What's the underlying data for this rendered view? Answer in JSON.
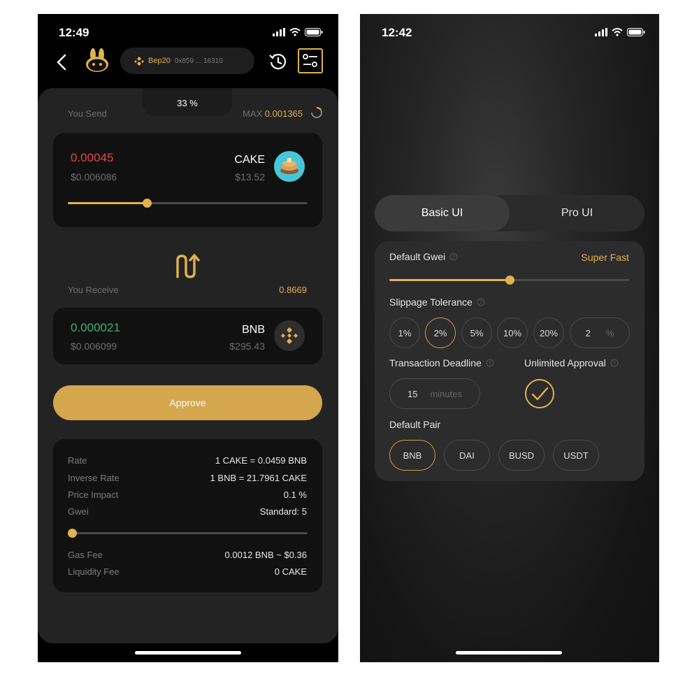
{
  "left": {
    "status_time": "12:49",
    "wallet_chain": "Bep20",
    "wallet_address": "0x859 ... 16310",
    "send": {
      "label": "You Send",
      "percent": "33 %",
      "max_label": "MAX",
      "max_value": "0.001365",
      "amount": "0.00045",
      "amount_usd": "$0.006086",
      "token": "CAKE",
      "token_price": "$13.52",
      "slider_fraction": 0.33
    },
    "receive": {
      "label": "You Receive",
      "value": "0.8669",
      "amount": "0.000021",
      "amount_usd": "$0.006099",
      "token": "BNB",
      "token_price": "$295.43"
    },
    "approve_label": "Approve",
    "details": {
      "rows": [
        {
          "label": "Rate",
          "value": "1 CAKE = 0.0459 BNB"
        },
        {
          "label": "Inverse Rate",
          "value": "1 BNB = 21.7961 CAKE"
        },
        {
          "label": "Price Impact",
          "value": "0.1 %"
        },
        {
          "label": "Gwei",
          "value": "Standard: 5"
        }
      ],
      "gwei_slider_fraction": 0.0,
      "fees": [
        {
          "label": "Gas Fee",
          "value": "0.0012 BNB ~ $0.36"
        },
        {
          "label": "Liquidity Fee",
          "value": "0 CAKE"
        }
      ]
    },
    "colors": {
      "accent": "#e0b24f",
      "send_amount": "#e0474c",
      "receive_amount": "#3fae7a"
    }
  },
  "right": {
    "status_time": "12:42",
    "tabs": [
      {
        "label": "Basic UI",
        "active": true
      },
      {
        "label": "Pro UI",
        "active": false
      }
    ],
    "gwei": {
      "label": "Default Gwei",
      "value": "Super Fast",
      "slider_fraction": 0.5
    },
    "slippage": {
      "label": "Slippage Tolerance",
      "options": [
        "1%",
        "2%",
        "5%",
        "10%",
        "20%"
      ],
      "selected": "2%",
      "custom_value": "2",
      "custom_unit": "%"
    },
    "deadline": {
      "label": "Transaction Deadline",
      "value": "15",
      "unit": "minutes"
    },
    "unlimited": {
      "label": "Unlimited Approval",
      "checked": true
    },
    "default_pair": {
      "label": "Default Pair",
      "options": [
        "BNB",
        "DAI",
        "BUSD",
        "USDT"
      ],
      "selected": "BNB"
    }
  }
}
